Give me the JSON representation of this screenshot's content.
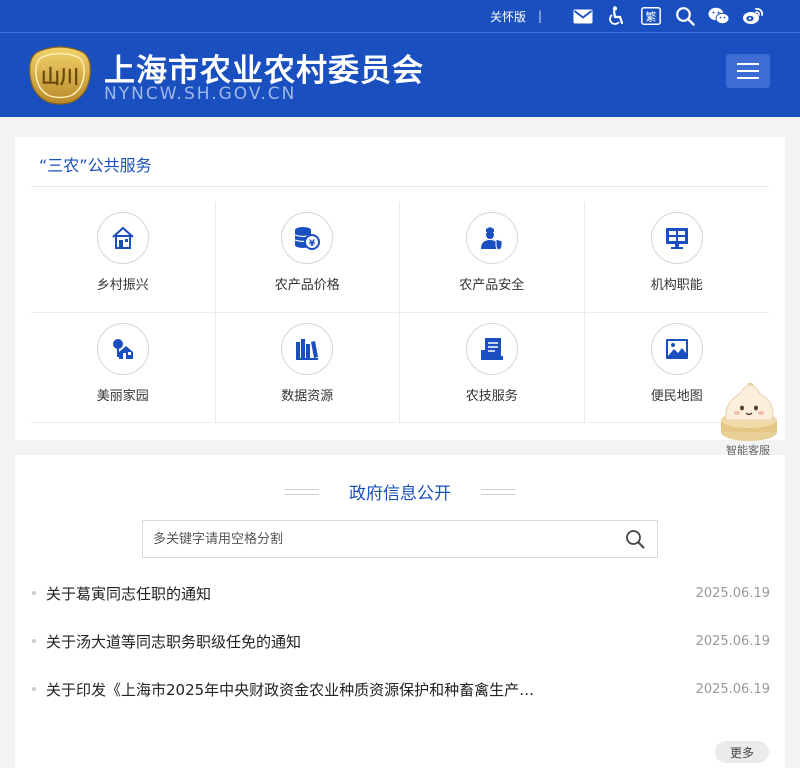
{
  "topbar": {
    "care_mode": "关怀版",
    "separator": "|",
    "icons": [
      "mail-icon",
      "accessibility-icon",
      "traditional-chinese-icon",
      "search-icon",
      "wechat-icon",
      "weibo-icon"
    ],
    "trad_char": "繁"
  },
  "header": {
    "title": "上海市农业农村委员会",
    "domain": "NYNCW.SH.GOV.CN",
    "logo_text": "山川"
  },
  "services": {
    "title": "“三农”公共服务",
    "items": [
      {
        "label": "乡村振兴",
        "icon": "rural-house-icon"
      },
      {
        "label": "农产品价格",
        "icon": "coins-price-icon"
      },
      {
        "label": "农产品安全",
        "icon": "user-safety-icon"
      },
      {
        "label": "机构职能",
        "icon": "monitor-org-icon"
      },
      {
        "label": "美丽家园",
        "icon": "beautiful-home-icon"
      },
      {
        "label": "数据资源",
        "icon": "books-data-icon"
      },
      {
        "label": "农技服务",
        "icon": "manual-service-icon"
      },
      {
        "label": "便民地图",
        "icon": "map-picture-icon"
      }
    ]
  },
  "assistant": {
    "label": "智能客服"
  },
  "info": {
    "title": "政府信息公开",
    "search_placeholder": "多关键字请用空格分割",
    "news": [
      {
        "title": "关于葛寅同志任职的通知",
        "date": "2025.06.19"
      },
      {
        "title": "关于汤大道等同志职务职级任免的通知",
        "date": "2025.06.19"
      },
      {
        "title": "关于印发《上海市2025年中央财政资金农业种质资源保护和种畜禽生产…",
        "date": "2025.06.19"
      }
    ],
    "more_label": "更多"
  },
  "colors": {
    "brand_blue": "#1a4fbf",
    "menu_button": "#3d6dd4",
    "page_bg": "#f2f3f5"
  }
}
